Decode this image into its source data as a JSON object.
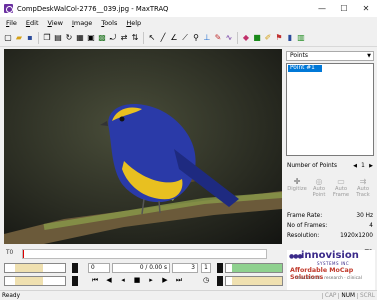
{
  "window": {
    "title": "CompDeskWalCol-2776__039.jpg - MaxTRAQ",
    "minimize": "—",
    "maximize": "☐",
    "close": "✕"
  },
  "menu": [
    "File",
    "Edit",
    "View",
    "Image",
    "Tools",
    "Help"
  ],
  "side": {
    "points_dropdown": "Points",
    "points_list": [
      "Point #1"
    ],
    "num_points_label": "Number of Points",
    "num_points_value": "1",
    "tools": [
      {
        "label": "Digitize",
        "icon": "digitize-icon"
      },
      {
        "label": "Auto Point",
        "icon": "auto-point-icon"
      },
      {
        "label": "Auto Frame",
        "icon": "auto-frame-icon"
      },
      {
        "label": "Auto Track",
        "icon": "auto-track-icon"
      }
    ],
    "info": {
      "frame_rate_label": "Frame Rate:",
      "frame_rate_value": "30 Hz",
      "frames_label": "No of Frames:",
      "frames_value": "4",
      "resolution_label": "Resolution:",
      "resolution_value": "1920x1200"
    }
  },
  "timeline": {
    "start_label": "T0",
    "end_label": "T1"
  },
  "transport": {
    "frame_start": "0",
    "frame_time": "0 / 0.00 s",
    "frame_end": "3",
    "speed": "1"
  },
  "logo": {
    "dots": "●●●",
    "name": "innovision",
    "sub": "SYSTEMS INC",
    "tagline": "Affordable MoCap Solutions",
    "tagline2": "educational · research · clinical"
  },
  "status": {
    "text": "Ready",
    "cells": [
      "CAP",
      "NUM",
      "SCRL"
    ],
    "active": "NUM"
  },
  "colors": {
    "selection": "#0078d7",
    "logo": "#3b2a8a",
    "tagline": "#c0392b",
    "range_fill": "#efe0b0",
    "right_range_fill": "#8fd18f"
  }
}
